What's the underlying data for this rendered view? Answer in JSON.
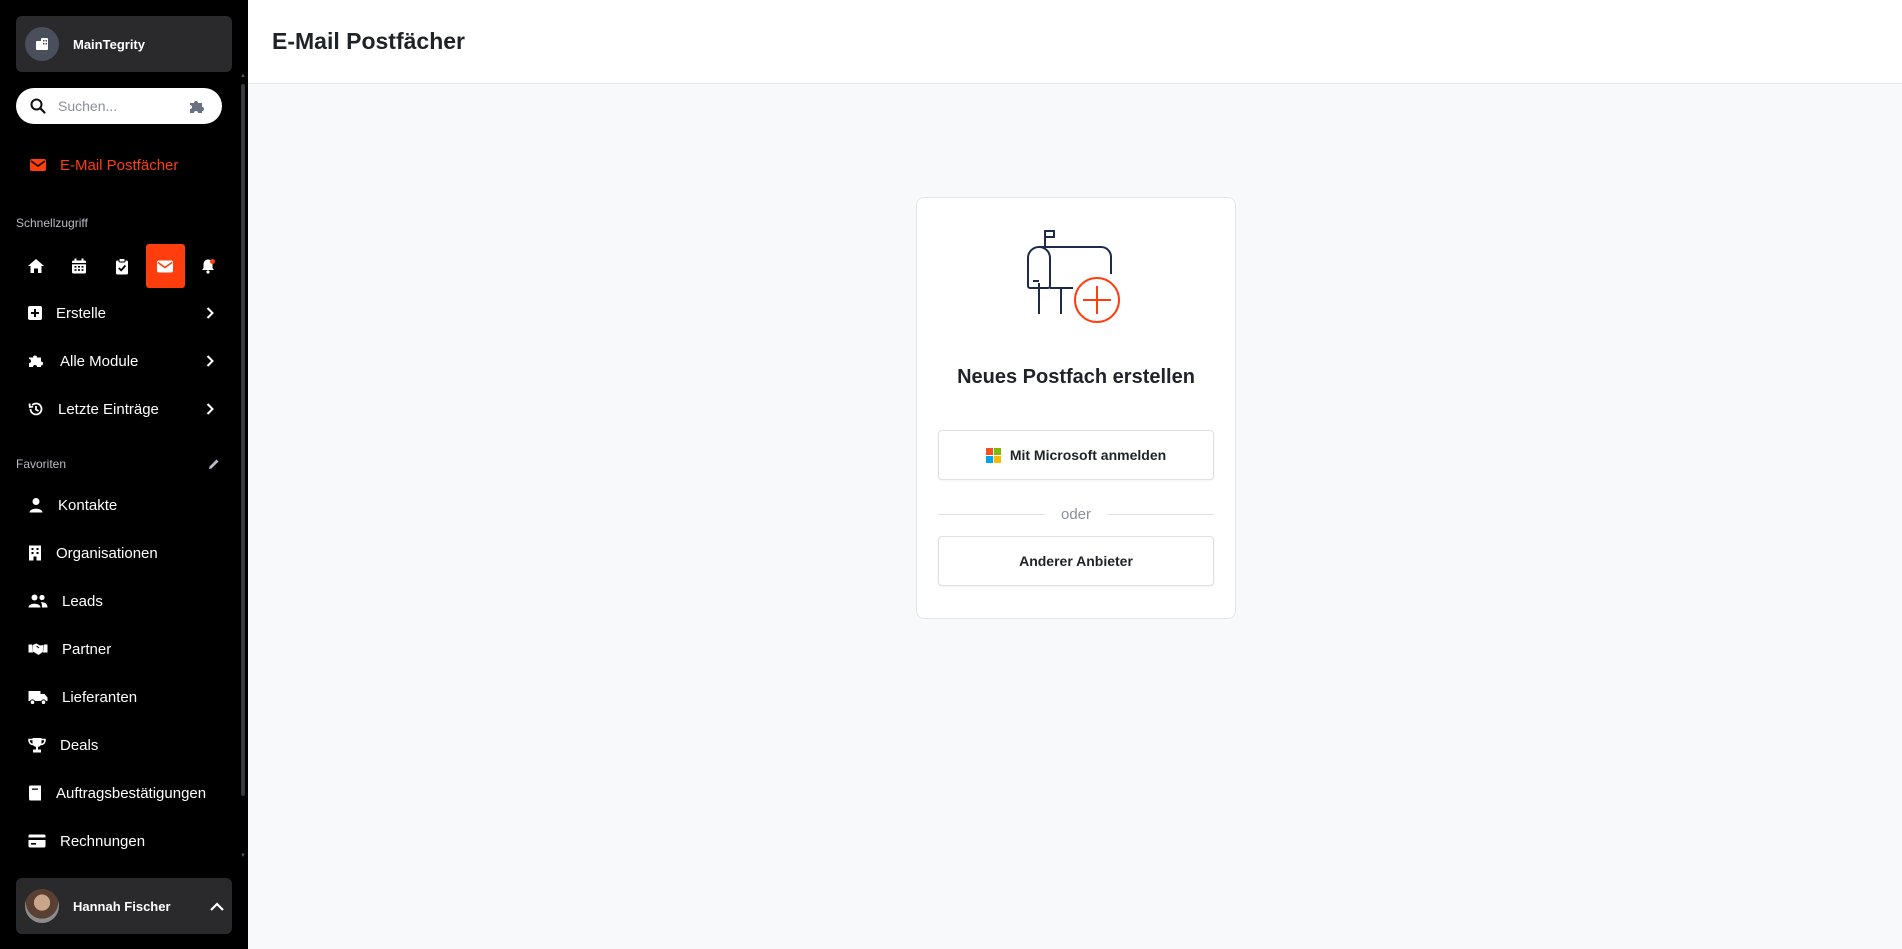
{
  "sidebar": {
    "org_name": "MainTegrity",
    "search_placeholder": "Suchen...",
    "active_item": "E-Mail Postfächer",
    "quick_access_label": "Schnellzugriff",
    "quick_access": [
      {
        "icon": "home-icon",
        "active": false
      },
      {
        "icon": "calendar-icon",
        "active": false
      },
      {
        "icon": "clipboard-check-icon",
        "active": false
      },
      {
        "icon": "mail-icon",
        "active": true
      },
      {
        "icon": "bell-icon",
        "active": false
      }
    ],
    "menu": [
      {
        "label": "Erstelle",
        "icon": "plus-square-icon"
      },
      {
        "label": "Alle Module",
        "icon": "puzzle-icon"
      },
      {
        "label": "Letzte Einträge",
        "icon": "history-icon"
      }
    ],
    "favorites_label": "Favoriten",
    "favorites": [
      {
        "label": "Kontakte",
        "icon": "person-icon"
      },
      {
        "label": "Organisationen",
        "icon": "building-icon"
      },
      {
        "label": "Leads",
        "icon": "people-icon"
      },
      {
        "label": "Partner",
        "icon": "handshake-icon"
      },
      {
        "label": "Lieferanten",
        "icon": "truck-icon"
      },
      {
        "label": "Deals",
        "icon": "trophy-icon"
      },
      {
        "label": "Auftragsbestätigungen",
        "icon": "book-icon"
      },
      {
        "label": "Rechnungen",
        "icon": "credit-card-icon"
      }
    ],
    "user_name": "Hannah Fischer"
  },
  "header": {
    "title": "E-Mail Postfächer"
  },
  "main": {
    "card_title": "Neues Postfach erstellen",
    "microsoft_button": "Mit Microsoft anmelden",
    "divider_text": "oder",
    "other_button": "Anderer Anbieter"
  },
  "colors": {
    "accent": "#ff3d0d",
    "sidebar_bg": "#000000",
    "illustration_stroke": "#1e2a4a",
    "ms_red": "#f25022",
    "ms_green": "#7fba00",
    "ms_blue": "#00a4ef",
    "ms_yellow": "#ffb900"
  }
}
